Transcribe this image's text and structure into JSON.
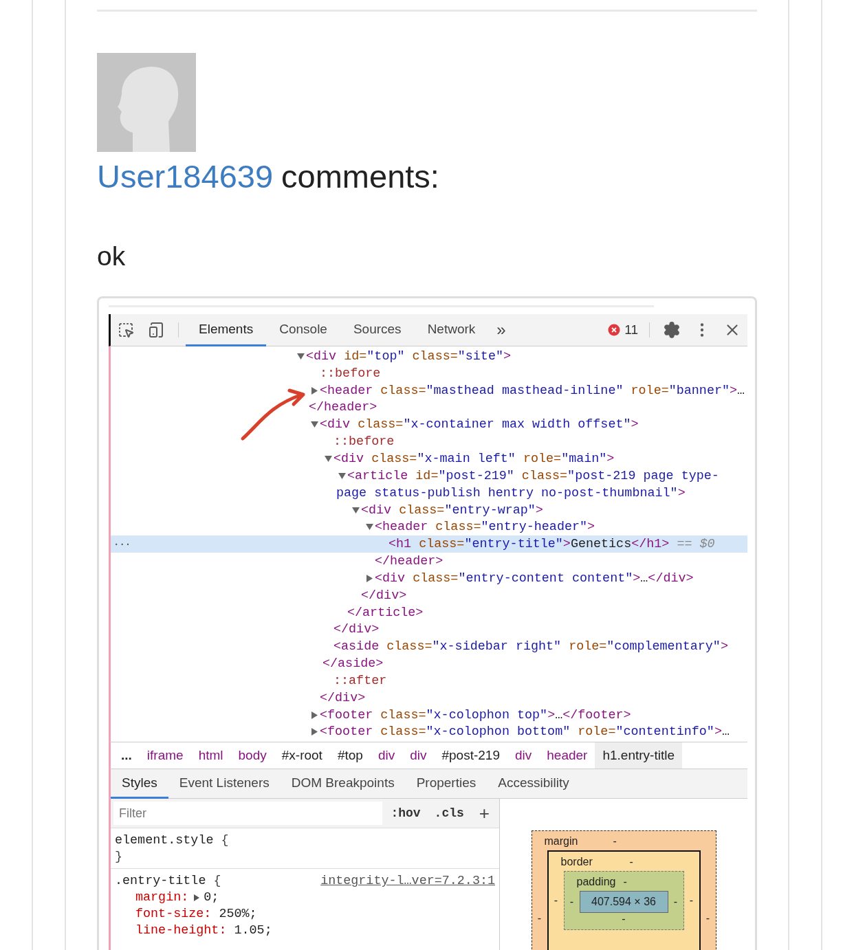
{
  "comment": {
    "author": "User184639",
    "suffix": "comments:",
    "body": "ok"
  },
  "devtools": {
    "tabs": [
      {
        "label": "Elements",
        "selected": true
      },
      {
        "label": "Console",
        "selected": false
      },
      {
        "label": "Sources",
        "selected": false
      },
      {
        "label": "Network",
        "selected": false
      }
    ],
    "more_tabs": "»",
    "error_count": "11",
    "dom": [
      {
        "expanded": true,
        "selected": false,
        "parts": [
          {
            "kind": "tag",
            "text": "<div"
          },
          {
            "kind": "attr",
            "text": " id="
          },
          {
            "kind": "value",
            "text": "\"top\""
          },
          {
            "kind": "attr",
            "text": " class="
          },
          {
            "kind": "value",
            "text": "\"site\""
          },
          {
            "kind": "tag",
            "text": ">"
          }
        ],
        "children": [
          {
            "selected": false,
            "parts": [
              {
                "kind": "pseudo",
                "text": "::before"
              }
            ]
          },
          {
            "expanded": false,
            "selected": false,
            "parts": [
              {
                "kind": "tag",
                "text": "<header"
              },
              {
                "kind": "attr",
                "text": " class="
              },
              {
                "kind": "value",
                "text": "\"masthead masthead-inline\""
              },
              {
                "kind": "attr",
                "text": " role="
              },
              {
                "kind": "value",
                "text": "\"banner\""
              },
              {
                "kind": "tag",
                "text": ">"
              },
              {
                "kind": "text",
                "text": "…"
              }
            ],
            "continuation": [
              {
                "kind": "tag",
                "text": "</header>"
              }
            ]
          },
          {
            "expanded": true,
            "selected": false,
            "parts": [
              {
                "kind": "tag",
                "text": "<div"
              },
              {
                "kind": "attr",
                "text": " class="
              },
              {
                "kind": "value",
                "text": "\"x-container max width offset\""
              },
              {
                "kind": "tag",
                "text": ">"
              }
            ],
            "children": [
              {
                "selected": false,
                "parts": [
                  {
                    "kind": "pseudo",
                    "text": "::before"
                  }
                ]
              },
              {
                "expanded": true,
                "selected": false,
                "parts": [
                  {
                    "kind": "tag",
                    "text": "<div"
                  },
                  {
                    "kind": "attr",
                    "text": " class="
                  },
                  {
                    "kind": "value",
                    "text": "\"x-main left\""
                  },
                  {
                    "kind": "attr",
                    "text": " role="
                  },
                  {
                    "kind": "value",
                    "text": "\"main\""
                  },
                  {
                    "kind": "tag",
                    "text": ">"
                  }
                ],
                "children": [
                  {
                    "expanded": true,
                    "selected": false,
                    "parts": [
                      {
                        "kind": "tag",
                        "text": "<article"
                      },
                      {
                        "kind": "attr",
                        "text": " id="
                      },
                      {
                        "kind": "value",
                        "text": "\"post-219\""
                      },
                      {
                        "kind": "attr",
                        "text": " class="
                      },
                      {
                        "kind": "value",
                        "text": "\"post-219 page type-"
                      }
                    ],
                    "continuation": [
                      {
                        "kind": "value",
                        "text": "page status-publish hentry no-post-thumbnail\""
                      },
                      {
                        "kind": "tag",
                        "text": ">"
                      }
                    ],
                    "children": [
                      {
                        "expanded": true,
                        "selected": false,
                        "parts": [
                          {
                            "kind": "tag",
                            "text": "<div"
                          },
                          {
                            "kind": "attr",
                            "text": " class="
                          },
                          {
                            "kind": "value",
                            "text": "\"entry-wrap\""
                          },
                          {
                            "kind": "tag",
                            "text": ">"
                          }
                        ],
                        "children": [
                          {
                            "expanded": true,
                            "selected": false,
                            "parts": [
                              {
                                "kind": "tag",
                                "text": "<header"
                              },
                              {
                                "kind": "attr",
                                "text": " class="
                              },
                              {
                                "kind": "value",
                                "text": "\"entry-header\""
                              },
                              {
                                "kind": "tag",
                                "text": ">"
                              }
                            ],
                            "children": [
                              {
                                "selected": true,
                                "gutter": "...",
                                "parts": [
                                  {
                                    "kind": "tag",
                                    "text": "<h1"
                                  },
                                  {
                                    "kind": "attr",
                                    "text": " class="
                                  },
                                  {
                                    "kind": "value",
                                    "text": "\"entry-title\""
                                  },
                                  {
                                    "kind": "tag",
                                    "text": ">"
                                  },
                                  {
                                    "kind": "text",
                                    "text": "Genetics"
                                  },
                                  {
                                    "kind": "tag",
                                    "text": "</h1>"
                                  },
                                  {
                                    "kind": "note",
                                    "text": " == "
                                  },
                                  {
                                    "kind": "var",
                                    "text": "$0"
                                  }
                                ]
                              }
                            ],
                            "closing": [
                              {
                                "kind": "tag",
                                "text": "</header>"
                              }
                            ]
                          },
                          {
                            "expanded": false,
                            "selected": false,
                            "parts": [
                              {
                                "kind": "tag",
                                "text": "<div"
                              },
                              {
                                "kind": "attr",
                                "text": " class="
                              },
                              {
                                "kind": "value",
                                "text": "\"entry-content content\""
                              },
                              {
                                "kind": "tag",
                                "text": ">"
                              },
                              {
                                "kind": "text",
                                "text": "…"
                              },
                              {
                                "kind": "tag",
                                "text": "</div>"
                              }
                            ]
                          }
                        ],
                        "closing": [
                          {
                            "kind": "tag",
                            "text": "</div>"
                          }
                        ]
                      }
                    ],
                    "closing": [
                      {
                        "kind": "tag",
                        "text": "</article>"
                      }
                    ]
                  }
                ],
                "closing": [
                  {
                    "kind": "tag",
                    "text": "</div>"
                  }
                ]
              },
              {
                "selected": false,
                "parts": [
                  {
                    "kind": "tag",
                    "text": "<aside"
                  },
                  {
                    "kind": "attr",
                    "text": " class="
                  },
                  {
                    "kind": "value",
                    "text": "\"x-sidebar right\""
                  },
                  {
                    "kind": "attr",
                    "text": " role="
                  },
                  {
                    "kind": "value",
                    "text": "\"complementary\""
                  },
                  {
                    "kind": "tag",
                    "text": ">"
                  }
                ],
                "continuation": [
                  {
                    "kind": "tag",
                    "text": "</aside>"
                  }
                ]
              },
              {
                "selected": false,
                "parts": [
                  {
                    "kind": "pseudo",
                    "text": "::after"
                  }
                ]
              }
            ],
            "closing": [
              {
                "kind": "tag",
                "text": "</div>"
              }
            ]
          },
          {
            "expanded": false,
            "selected": false,
            "parts": [
              {
                "kind": "tag",
                "text": "<footer"
              },
              {
                "kind": "attr",
                "text": " class="
              },
              {
                "kind": "value",
                "text": "\"x-colophon top\""
              },
              {
                "kind": "tag",
                "text": ">"
              },
              {
                "kind": "text",
                "text": "…"
              },
              {
                "kind": "tag",
                "text": "</footer>"
              }
            ]
          },
          {
            "expanded": false,
            "selected": false,
            "parts": [
              {
                "kind": "tag",
                "text": "<footer"
              },
              {
                "kind": "attr",
                "text": " class="
              },
              {
                "kind": "value",
                "text": "\"x-colophon bottom\""
              },
              {
                "kind": "attr",
                "text": " role="
              },
              {
                "kind": "value",
                "text": "\"contentinfo\""
              },
              {
                "kind": "tag",
                "text": ">"
              },
              {
                "kind": "text",
                "text": "…"
              }
            ]
          }
        ]
      }
    ],
    "breadcrumbs": [
      {
        "label": "...",
        "kind": "more",
        "selected": false
      },
      {
        "label": "iframe",
        "kind": "tag",
        "selected": false
      },
      {
        "label": "html",
        "kind": "tag",
        "selected": false
      },
      {
        "label": "body",
        "kind": "tag",
        "selected": false
      },
      {
        "label": "#x-root",
        "kind": "id",
        "selected": false
      },
      {
        "label": "#top",
        "kind": "id",
        "selected": false
      },
      {
        "label": "div",
        "kind": "tag",
        "selected": false
      },
      {
        "label": "div",
        "kind": "tag",
        "selected": false
      },
      {
        "label": "#post-219",
        "kind": "id",
        "selected": false
      },
      {
        "label": "div",
        "kind": "tag",
        "selected": false
      },
      {
        "label": "header",
        "kind": "tag",
        "selected": false
      },
      {
        "label": "h1.entry-title",
        "kind": "id",
        "selected": true
      }
    ],
    "panel_tabs": [
      {
        "label": "Styles",
        "selected": true
      },
      {
        "label": "Event Listeners",
        "selected": false
      },
      {
        "label": "DOM Breakpoints",
        "selected": false
      },
      {
        "label": "Properties",
        "selected": false
      },
      {
        "label": "Accessibility",
        "selected": false
      }
    ],
    "styles": {
      "filter": {
        "placeholder": "Filter"
      },
      "hov": ":hov",
      "cls": ".cls",
      "add": "+",
      "rules": [
        {
          "selector": "element.style",
          "open": "{",
          "close": "}"
        },
        {
          "selector": ".entry-title",
          "open": "{",
          "source": "integrity-l…ver=7.2.3:1",
          "properties": [
            {
              "name": "margin:",
              "value": "0;",
              "expandable": true
            },
            {
              "name": "font-size:",
              "value": "250%;",
              "expandable": false
            },
            {
              "name": "line-height:",
              "value": "1.05;",
              "expandable": false
            }
          ]
        }
      ]
    },
    "box_model": {
      "margin_label": "margin",
      "margin_top": "-",
      "border_label": "border",
      "border_top": "-",
      "padding_label": "padding",
      "padding_top": "-",
      "content": "407.594 × 36",
      "margin_left": "-",
      "border_left": "-",
      "padding_left": "-",
      "padding_right": "-",
      "border_right": "-",
      "margin_right": "-",
      "padding_bottom": "-"
    }
  }
}
